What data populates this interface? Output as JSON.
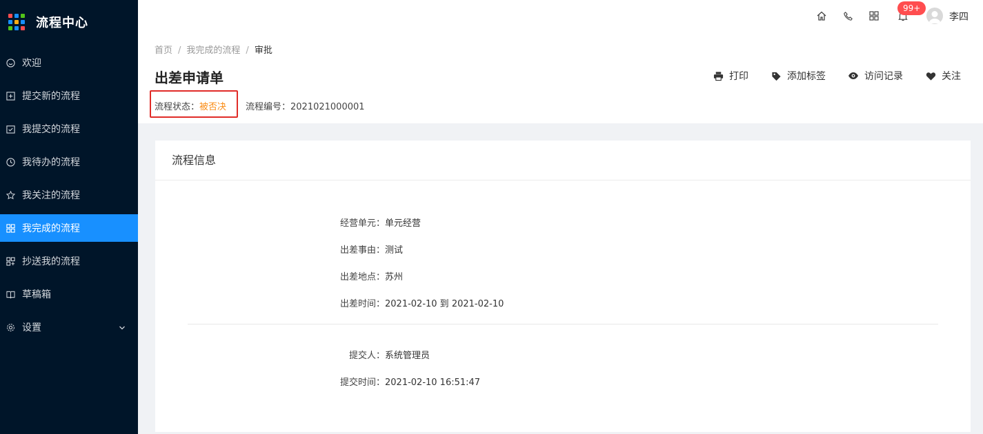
{
  "app": {
    "title": "流程中心"
  },
  "sidebar": {
    "items": [
      {
        "label": "欢迎",
        "icon": "smile-icon"
      },
      {
        "label": "提交新的流程",
        "icon": "plus-square-icon"
      },
      {
        "label": "我提交的流程",
        "icon": "check-square-icon"
      },
      {
        "label": "我待办的流程",
        "icon": "clock-icon"
      },
      {
        "label": "我关注的流程",
        "icon": "star-icon"
      },
      {
        "label": "我完成的流程",
        "icon": "grid-icon"
      },
      {
        "label": "抄送我的流程",
        "icon": "copy-grid-icon"
      },
      {
        "label": "草稿箱",
        "icon": "book-icon"
      },
      {
        "label": "设置",
        "icon": "gear-icon"
      }
    ],
    "active_index": 5
  },
  "header": {
    "notification_badge": "99+",
    "username": "李四",
    "icons": [
      "home-icon",
      "phone-icon",
      "apps-icon",
      "bell-icon"
    ]
  },
  "breadcrumb": {
    "home": "首页",
    "parent": "我完成的流程",
    "current": "审批"
  },
  "page": {
    "title": "出差申请单",
    "status_label": "流程状态：",
    "status_value": "被否决",
    "flow_no_label": "流程编号：",
    "flow_no_value": "2021021000001"
  },
  "actions": {
    "print": "打印",
    "add_tag": "添加标签",
    "visit_log": "访问记录",
    "follow": "关注"
  },
  "card": {
    "title": "流程信息",
    "fields": [
      {
        "label": "经营单元：",
        "value": "单元经营"
      },
      {
        "label": "出差事由：",
        "value": "测试"
      },
      {
        "label": "出差地点：",
        "value": "苏州"
      },
      {
        "label": "出差时间：",
        "value": "2021-02-10 到 2021-02-10"
      },
      {
        "label": "提交人：",
        "value": "系统管理员"
      },
      {
        "label": "提交时间：",
        "value": "2021-02-10 16:51:47"
      }
    ]
  },
  "colors": {
    "sidebar_bg": "#001529",
    "accent": "#1890ff",
    "status_rejected": "#fa8c16",
    "highlight_box": "#e02b27",
    "badge": "#ff4d4f"
  }
}
